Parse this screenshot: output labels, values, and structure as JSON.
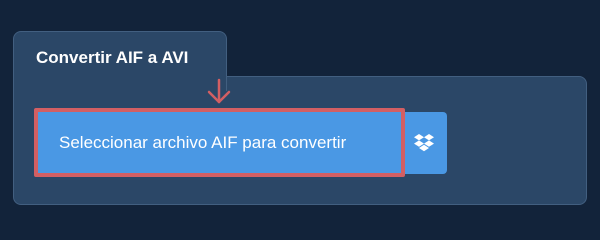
{
  "tab": {
    "title": "Convertir AIF a AVI"
  },
  "actions": {
    "select_file_label": "Seleccionar archivo AIF para convertir",
    "dropbox_icon": "dropbox-icon"
  },
  "colors": {
    "page_background": "#12233a",
    "panel_background": "#2b4767",
    "button_blue": "#4a98e4",
    "highlight_red": "#d35f63"
  }
}
